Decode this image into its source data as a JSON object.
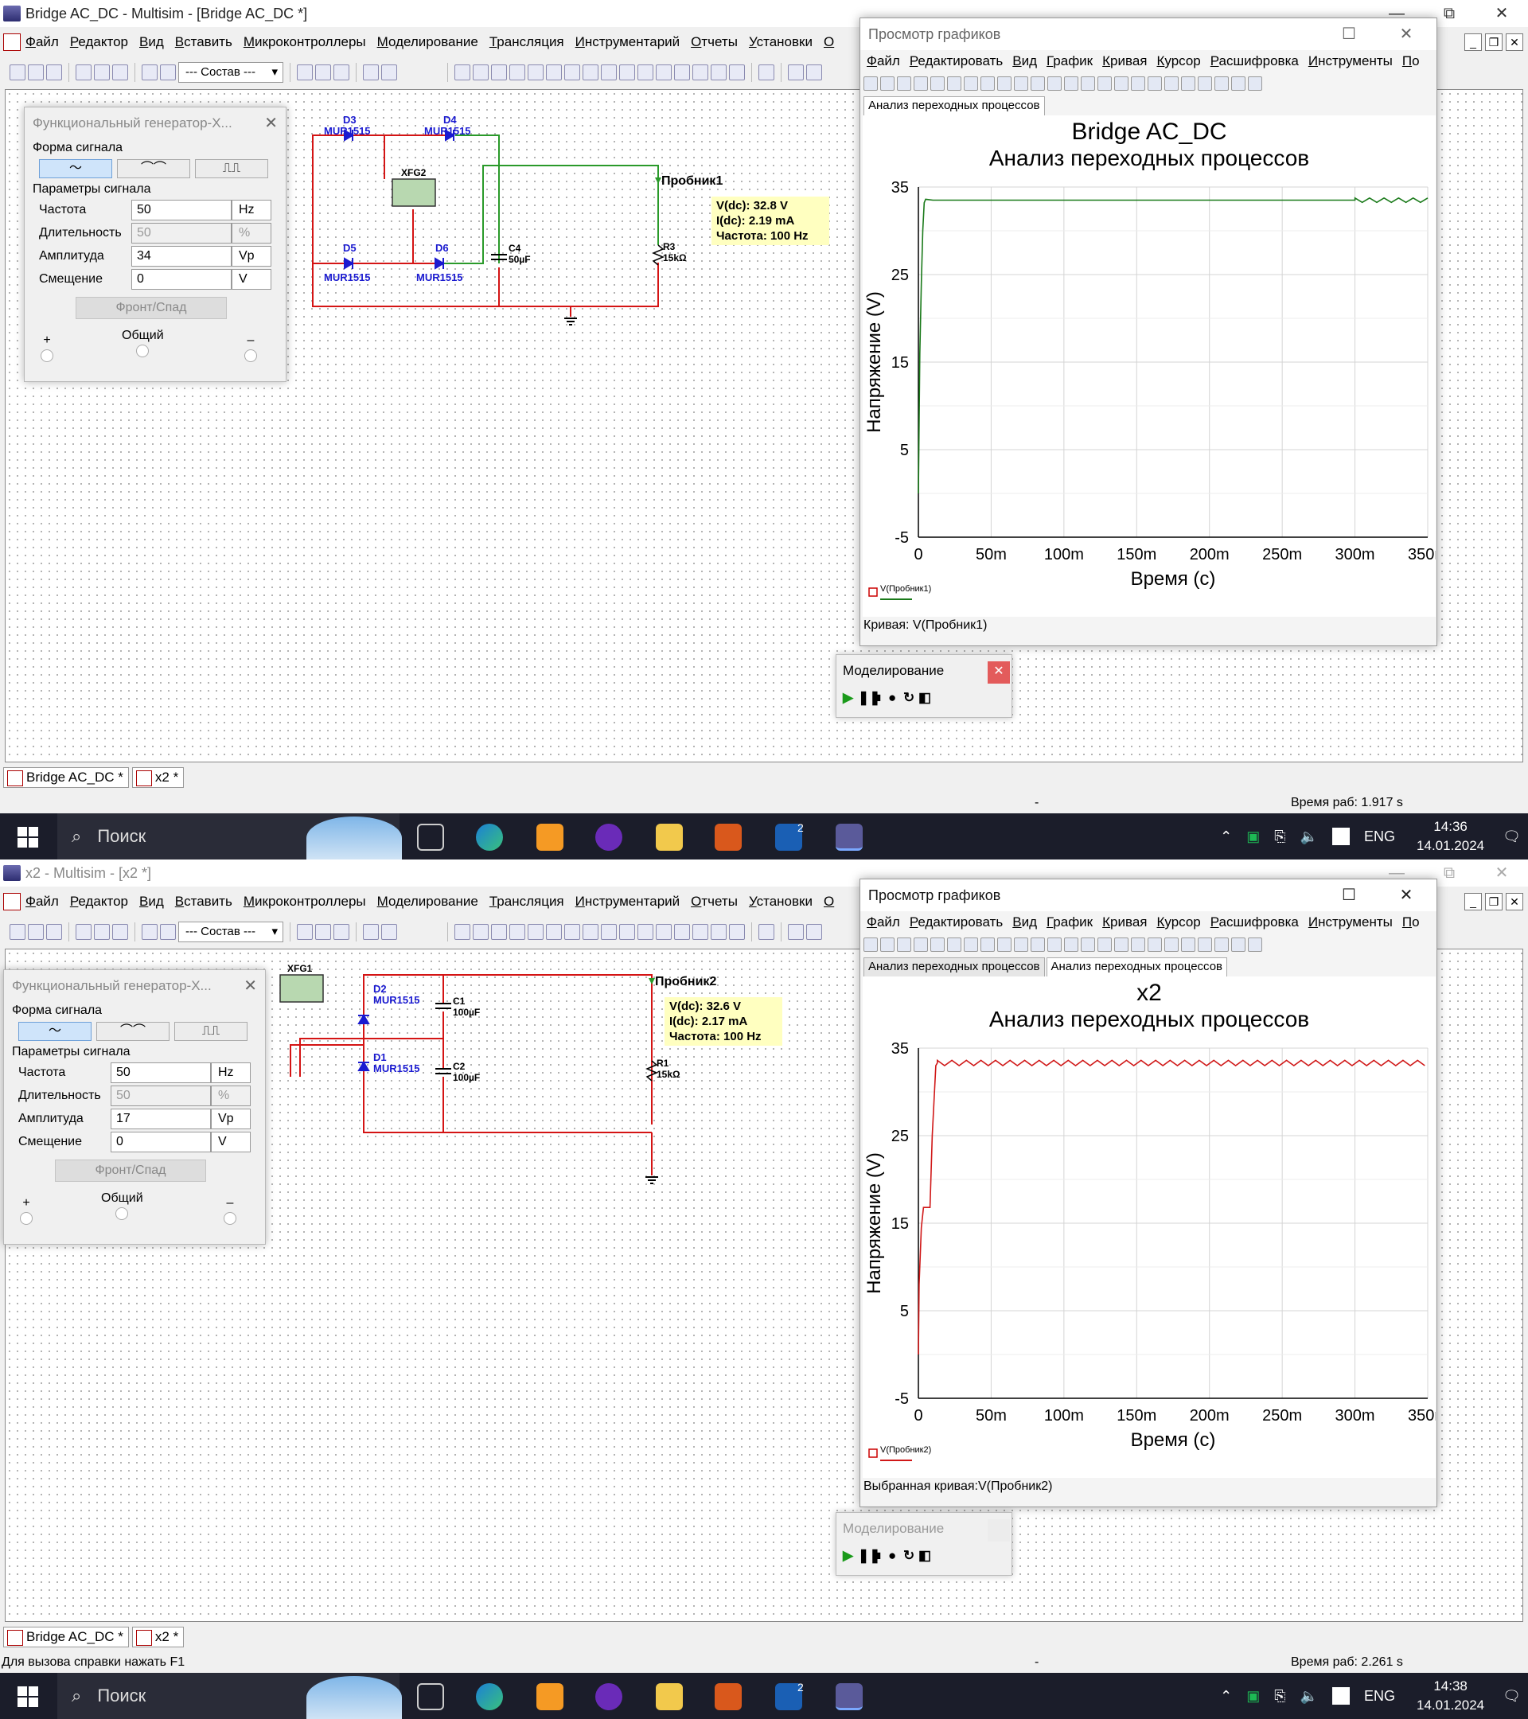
{
  "screen1": {
    "app_title": "Bridge AC_DC - Multisim - [Bridge AC_DC *]",
    "schematic": {
      "diodes": [
        "D3",
        "D4",
        "D5",
        "D6"
      ],
      "diode_model": "MUR1515",
      "generator": "XFG2",
      "capacitor": {
        "name": "C4",
        "value": "50µF"
      },
      "resistor": {
        "name": "R3",
        "value": "15kΩ"
      },
      "probe_name": "Пробник1",
      "probe_readout": [
        "V(dc): 32.8 V",
        "I(dc): 2.19 mA",
        "Частота: 100 Hz"
      ]
    },
    "func_gen": {
      "title": "Функциональный генератор-X...",
      "amplitude": "34"
    },
    "graph": {
      "titlebar": "Просмотр графиков",
      "tabs": [
        "Анализ переходных процессов"
      ],
      "plot_title": "Bridge AC_DC",
      "trace_label": "V(Пробник1)",
      "status": "Кривая: V(Пробник1)",
      "trace_color": "#1a7a1a"
    },
    "sim_panel_title": "Моделирование",
    "statusbar_left": "",
    "statusbar_right": "Время раб: 1.917 s"
  },
  "screen2": {
    "app_title": "x2 - Multisim - [x2 *]",
    "schematic": {
      "diodes": [
        "D2",
        "D1"
      ],
      "diode_model": "MUR1515",
      "generator": "XFG1",
      "capacitors": [
        {
          "name": "C1",
          "value": "100µF"
        },
        {
          "name": "C2",
          "value": "100µF"
        }
      ],
      "resistor": {
        "name": "R1",
        "value": "15kΩ"
      },
      "probe_name": "Пробник2",
      "probe_readout": [
        "V(dc): 32.6 V",
        "I(dc): 2.17 mA",
        "Частота: 100 Hz"
      ]
    },
    "func_gen": {
      "title": "Функциональный генератор-X...",
      "amplitude": "17"
    },
    "graph": {
      "titlebar": "Просмотр графиков",
      "tabs": [
        "Анализ переходных процессов",
        "Анализ переходных процессов"
      ],
      "plot_title": "x2",
      "trace_label": "V(Пробник2)",
      "status": "Выбранная кривая:V(Пробник2)",
      "trace_color": "#d01818"
    },
    "sim_panel_title": "Моделирование",
    "statusbar_left": "Для вызова справки нажать F1",
    "statusbar_right": "Время раб: 2.261 s"
  },
  "menu": [
    "Файл",
    "Редактор",
    "Вид",
    "Вставить",
    "Микроконтроллеры",
    "Моделирование",
    "Трансляция",
    "Инструментарий",
    "Отчеты",
    "Установки",
    "О"
  ],
  "toolbar_select": "--- Состав ---",
  "func_gen_labels": {
    "waveform_section": "Форма сигнала",
    "waveforms": [
      "〜",
      "⌒⌒",
      "⎍⎍"
    ],
    "params_section": "Параметры сигнала",
    "freq_label": "Частота",
    "freq_value": "50",
    "freq_unit": "Hz",
    "duty_label": "Длительность",
    "duty_value": "50",
    "duty_unit": "%",
    "amp_label": "Амплитуда",
    "amp_unit": "Vp",
    "offset_label": "Смещение",
    "offset_value": "0",
    "offset_unit": "V",
    "rise_fall": "Фронт/Спад",
    "plus": "+",
    "common": "Общий",
    "minus": "–"
  },
  "graph_menu": [
    "Файл",
    "Редактировать",
    "Вид",
    "График",
    "Кривая",
    "Курсор",
    "Расшифровка",
    "Инструменты",
    "По"
  ],
  "doc_tabs": [
    "Bridge AC_DC *",
    "x2 *"
  ],
  "taskbar": {
    "search": "Поиск",
    "lang": "ENG",
    "badge": "2",
    "time1": "14:36",
    "time2": "14:38",
    "date": "14.01.2024"
  },
  "chart_data": [
    {
      "type": "line",
      "title": "Bridge AC_DC",
      "subtitle": "Анализ переходных процессов",
      "xlabel": "Время (с)",
      "ylabel": "Напряжение (V)",
      "xlim": [
        0,
        0.35
      ],
      "ylim": [
        -5,
        35
      ],
      "xticks": [
        "0",
        "50m",
        "100m",
        "150m",
        "200m",
        "250m",
        "300m",
        "350m"
      ],
      "yticks": [
        "-5",
        "5",
        "15",
        "25",
        "35"
      ],
      "grid": true,
      "series": [
        {
          "name": "V(Пробник1)",
          "color": "#1a7a1a",
          "x": [
            0,
            0.0005,
            0.001,
            0.002,
            0.003,
            0.004,
            0.005,
            0.01,
            0.05,
            0.1,
            0.15,
            0.2,
            0.25,
            0.3,
            0.35
          ],
          "y": [
            0,
            8,
            16,
            24,
            30,
            33.2,
            33.6,
            33.5,
            33.5,
            33.5,
            33.5,
            33.5,
            33.5,
            33.5,
            33.5
          ],
          "ripple": 0.5,
          "ripple_period": 0.01
        }
      ]
    },
    {
      "type": "line",
      "title": "x2",
      "subtitle": "Анализ переходных процессов",
      "xlabel": "Время (с)",
      "ylabel": "Напряжение (V)",
      "xlim": [
        0,
        0.35
      ],
      "ylim": [
        -5,
        35
      ],
      "xticks": [
        "0",
        "50m",
        "100m",
        "150m",
        "200m",
        "250m",
        "300m",
        "350m"
      ],
      "yticks": [
        "-5",
        "5",
        "15",
        "25",
        "35"
      ],
      "grid": true,
      "series": [
        {
          "name": "V(Пробник2)",
          "color": "#d01818",
          "x": [
            0,
            0.0005,
            0.002,
            0.0035,
            0.004,
            0.008,
            0.0095,
            0.012,
            0.013,
            0.35
          ],
          "y": [
            0,
            8,
            14.5,
            16.8,
            16.8,
            16.8,
            25,
            33,
            33.3,
            33.3
          ],
          "ripple": 0.6,
          "ripple_period": 0.01
        }
      ]
    }
  ]
}
